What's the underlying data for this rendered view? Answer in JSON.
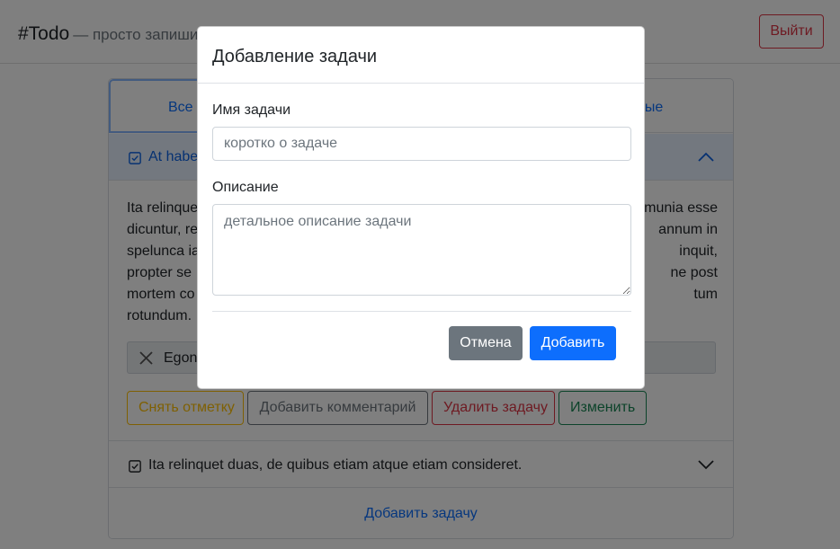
{
  "header": {
    "brand": "#Todo",
    "subtitle": "— просто запиши",
    "logout_label": "Выйти"
  },
  "tabs": {
    "all": "Все з",
    "done": "ные"
  },
  "tasks": [
    {
      "title": "At habe",
      "body": "Ita relinque ... munia esse dicuntur, re ... annum in spelunca ia ... inquit, propter se ... ne post mortem co ... tum rotundum.",
      "body_lines": [
        "Ita relinque",
        "dicuntur, re",
        "spelunca ia",
        "propter se",
        "mortem co",
        "rotundum."
      ],
      "body_lines_right": [
        "munia esse",
        "annum in",
        "inquit,",
        "ne post",
        "tum",
        ""
      ],
      "comment": "Egon",
      "buttons": {
        "unmark": "Снять отметку",
        "add_comment": "Добавить комментарий",
        "delete": "Удалить задачу",
        "edit": "Изменить"
      }
    },
    {
      "title": "Ita relinquet duas, de quibus etiam atque etiam consideret."
    }
  ],
  "add_task_link": "Добавить задачу",
  "modal": {
    "title": "Добавление задачи",
    "name_label": "Имя задачи",
    "name_placeholder": "коротко о задаче",
    "desc_label": "Описание",
    "desc_placeholder": "детальное описание задачи",
    "cancel_label": "Отмена",
    "submit_label": "Добавить"
  },
  "colors": {
    "primary": "#0d6efd",
    "danger": "#dc3545",
    "success": "#198754",
    "warning": "#ffc107",
    "secondary": "#6c757d"
  },
  "icons": [
    "check-square-icon",
    "chevron-up-icon",
    "chevron-down-icon",
    "close-icon"
  ]
}
